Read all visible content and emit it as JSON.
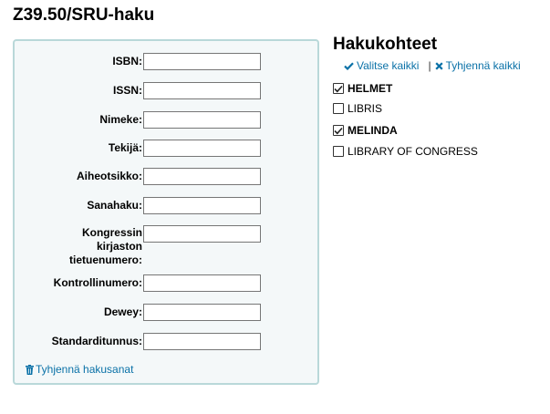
{
  "page": {
    "title": "Z39.50/SRU-haku"
  },
  "form": {
    "fields": [
      {
        "label": "ISBN:",
        "value": ""
      },
      {
        "label": "ISSN:",
        "value": ""
      },
      {
        "label": "Nimeke:",
        "value": ""
      },
      {
        "label": "Tekijä:",
        "value": ""
      },
      {
        "label": "Aiheotsikko:",
        "value": ""
      },
      {
        "label": "Sanahaku:",
        "value": ""
      },
      {
        "label_lines": [
          "Kongressin",
          "kirjaston",
          "tietuenumero:"
        ],
        "value": ""
      },
      {
        "label": "Kontrollinumero:",
        "value": ""
      },
      {
        "label": "Dewey:",
        "value": ""
      },
      {
        "label": "Standarditunnus:",
        "value": ""
      }
    ],
    "clear_terms_label": "Tyhjennä hakusanat",
    "clear_terms_icon": "trash-icon"
  },
  "targets": {
    "title": "Hakukohteet",
    "select_all_label": "Valitse kaikki",
    "select_all_icon": "check-icon",
    "clear_all_label": "Tyhjennä kaikki",
    "clear_all_icon": "x-icon",
    "items": [
      {
        "label": "HELMET",
        "checked": true
      },
      {
        "label": "LIBRIS",
        "checked": false
      },
      {
        "label": "MELINDA",
        "checked": true
      },
      {
        "label": "LIBRARY OF CONGRESS",
        "checked": false
      }
    ]
  },
  "colors": {
    "link": "#0a71a7",
    "panel_bg": "#f4f8f9",
    "panel_border": "#b9d8d9"
  }
}
